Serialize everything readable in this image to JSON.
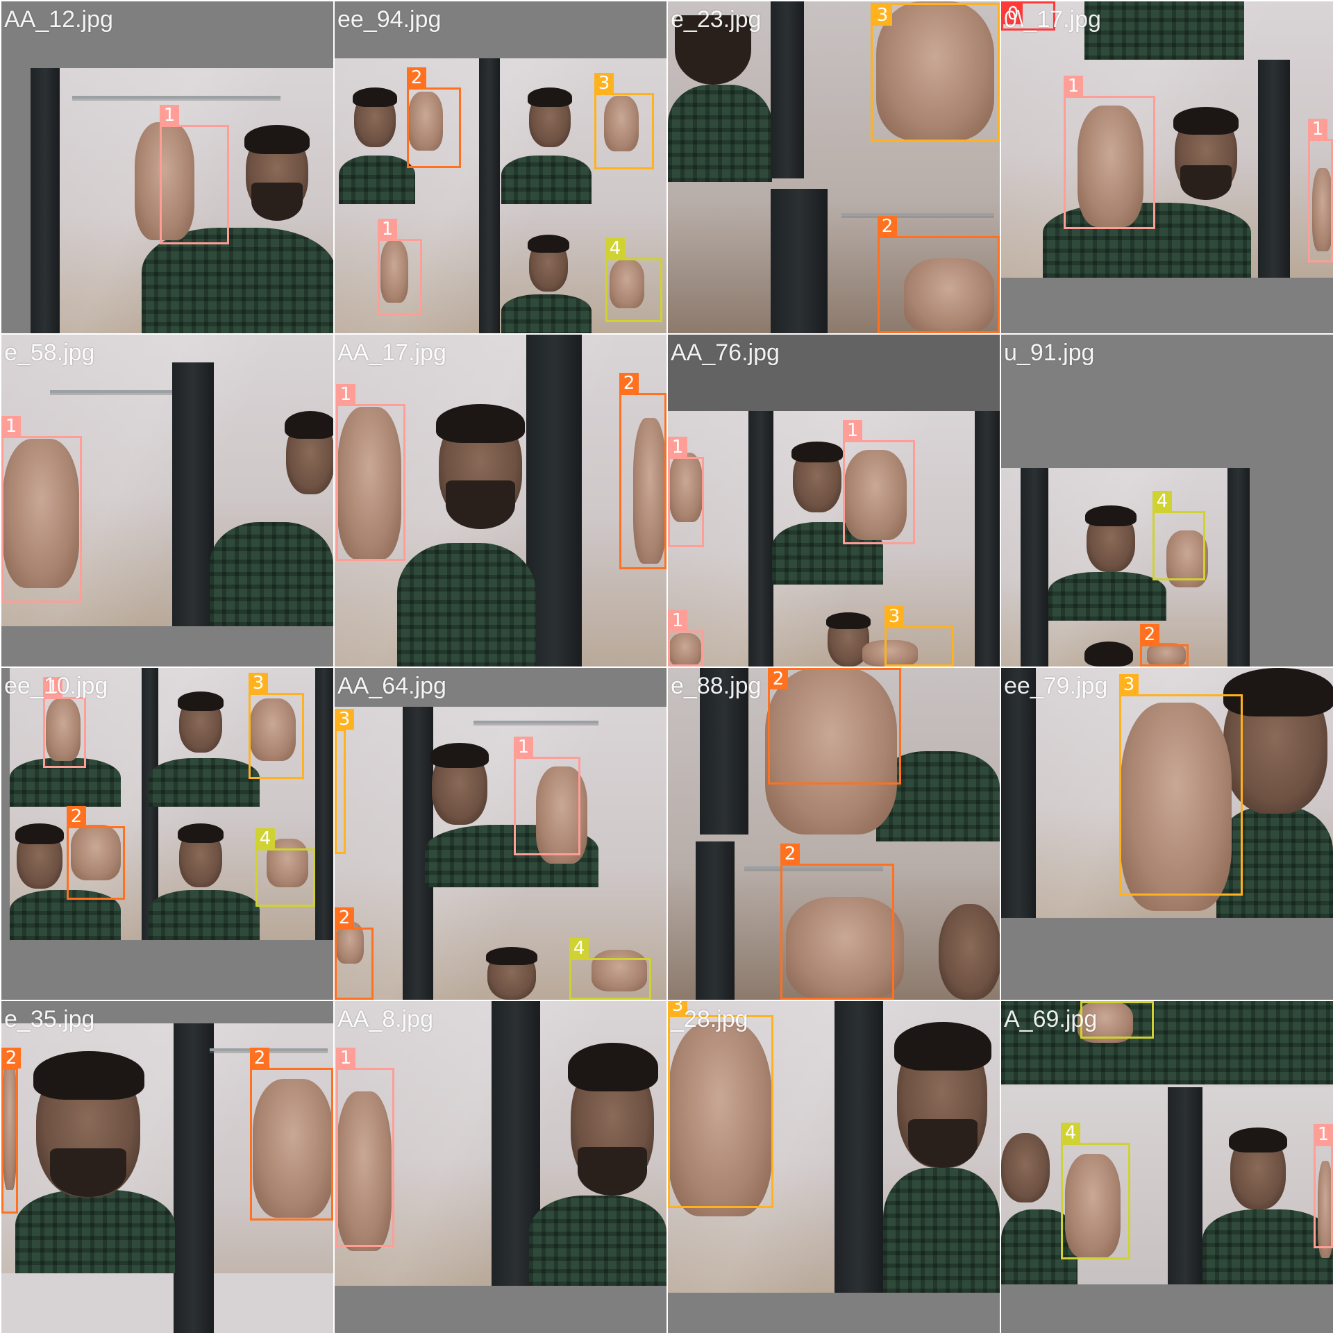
{
  "class_colors": {
    "0": "#ff3838",
    "1": "#ff9d97",
    "2": "#ff701f",
    "3": "#ffb21d",
    "4": "#cfd231"
  },
  "tiles": [
    {
      "title": "AA_12.jpg",
      "labels": [
        {
          "cls": "1"
        }
      ]
    },
    {
      "title": "ee_94.jpg",
      "labels": [
        {
          "cls": "2"
        },
        {
          "cls": "3"
        },
        {
          "cls": "1"
        },
        {
          "cls": "4"
        }
      ]
    },
    {
      "title": "e_23.jpg",
      "labels": [
        {
          "cls": "3"
        },
        {
          "cls": "2"
        }
      ]
    },
    {
      "title": "0\\_17.jpg",
      "labels": [
        {
          "cls": "1"
        },
        {
          "cls": "1"
        },
        {
          "cls": "0"
        }
      ]
    },
    {
      "title": "e_58.jpg",
      "labels": [
        {
          "cls": "1"
        }
      ]
    },
    {
      "title": "AA_17.jpg",
      "labels": [
        {
          "cls": "1"
        },
        {
          "cls": "2"
        }
      ]
    },
    {
      "title": "AA_76.jpg",
      "labels": [
        {
          "cls": "1"
        },
        {
          "cls": "1"
        },
        {
          "cls": "1"
        },
        {
          "cls": "3"
        }
      ]
    },
    {
      "title": "u_91.jpg",
      "labels": [
        {
          "cls": "4"
        },
        {
          "cls": "2"
        }
      ]
    },
    {
      "title": "ee_10.jpg",
      "labels": [
        {
          "cls": "1"
        },
        {
          "cls": "3"
        },
        {
          "cls": "2"
        },
        {
          "cls": "4"
        }
      ]
    },
    {
      "title": "AA_64.jpg",
      "labels": [
        {
          "cls": "3"
        },
        {
          "cls": "1"
        },
        {
          "cls": "2"
        },
        {
          "cls": "4"
        }
      ]
    },
    {
      "title": "e_88.jpg",
      "labels": [
        {
          "cls": "2"
        },
        {
          "cls": "2"
        }
      ]
    },
    {
      "title": "ee_79.jpg",
      "labels": [
        {
          "cls": "3"
        }
      ]
    },
    {
      "title": "e_35.jpg",
      "labels": [
        {
          "cls": "2"
        },
        {
          "cls": "2"
        }
      ]
    },
    {
      "title": "AA_8.jpg",
      "labels": [
        {
          "cls": "1"
        }
      ]
    },
    {
      "title": "_28.jpg",
      "labels": [
        {
          "cls": "3"
        }
      ]
    },
    {
      "title": "A_69.jpg",
      "labels": [
        {
          "cls": "4"
        },
        {
          "cls": "4"
        },
        {
          "cls": "1"
        }
      ]
    }
  ]
}
